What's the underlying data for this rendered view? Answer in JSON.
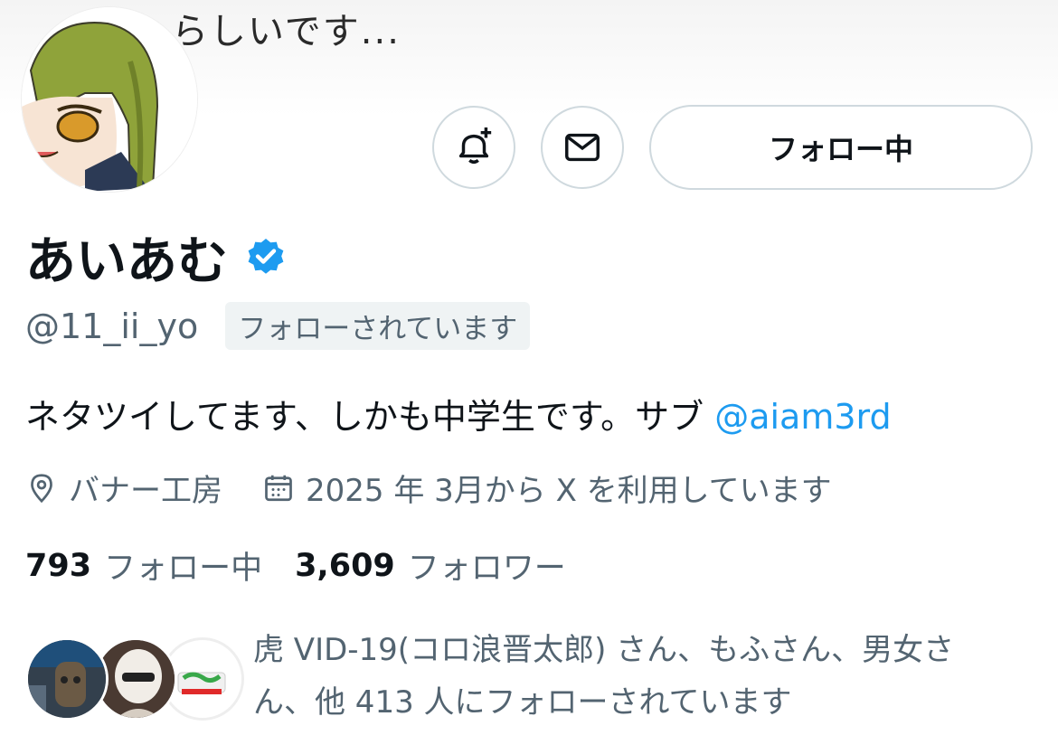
{
  "banner": {
    "text": "らしいです..."
  },
  "actions": {
    "notify_icon": "bell-plus-icon",
    "message_icon": "envelope-icon",
    "follow_label": "フォロー中"
  },
  "profile": {
    "name": "あいあむ",
    "verified_icon": "verified-badge-icon",
    "handle": "@11_ii_yo",
    "follows_you": "フォローされています",
    "bio_text": "ネタツイしてます、しかも中学生です。サブ ",
    "bio_link": "@aiam3rd",
    "location": "バナー工房",
    "joined": "2025 年 3月から X を利用しています"
  },
  "stats": {
    "following_count": "793",
    "following_label": "フォロー中",
    "followers_count": "3,609",
    "followers_label": "フォロワー"
  },
  "mutuals": {
    "text_line1": "虎 VID-19(コロ浪晋太郎) さん、もふさん、男女さ",
    "text_line2": "ん、他 413 人にフォローされています"
  },
  "colors": {
    "accent": "#1d9bf0",
    "secondary_text": "#536471",
    "border": "#cfd9de"
  }
}
